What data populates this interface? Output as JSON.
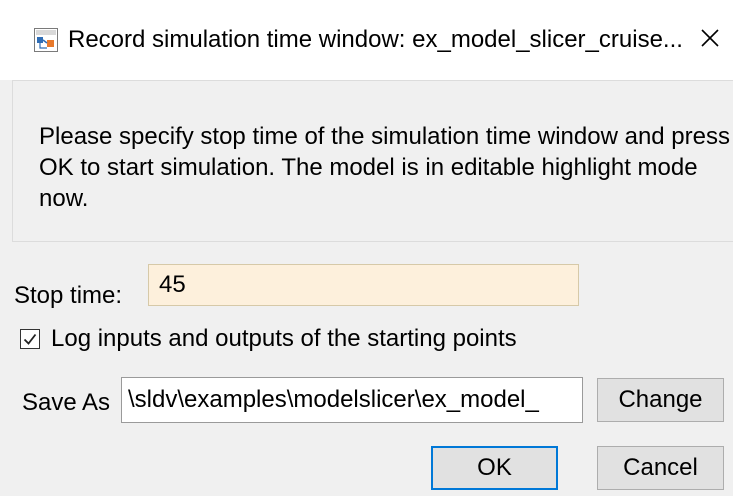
{
  "window": {
    "title": "Record simulation time window: ex_model_slicer_cruise...",
    "icon": "simulink-model-icon",
    "close_glyph": "✕"
  },
  "message": "Please specify stop time of the simulation time window and press OK to start simulation. The model is in editable highlight mode now.",
  "stop_time": {
    "label": "Stop time:",
    "value": "45"
  },
  "log_option": {
    "label": "Log inputs and outputs of the starting points",
    "checked": true
  },
  "save_as": {
    "label": "Save As",
    "value": "\\sldv\\examples\\modelslicer\\ex_model_",
    "change_label": "Change"
  },
  "buttons": {
    "ok_label": "OK",
    "cancel_label": "Cancel"
  },
  "colors": {
    "panel_bg": "#f0f0f0",
    "stop_input_bg": "#fdf0dc",
    "default_button_border": "#0078d7",
    "button_bg": "#e1e1e1"
  }
}
